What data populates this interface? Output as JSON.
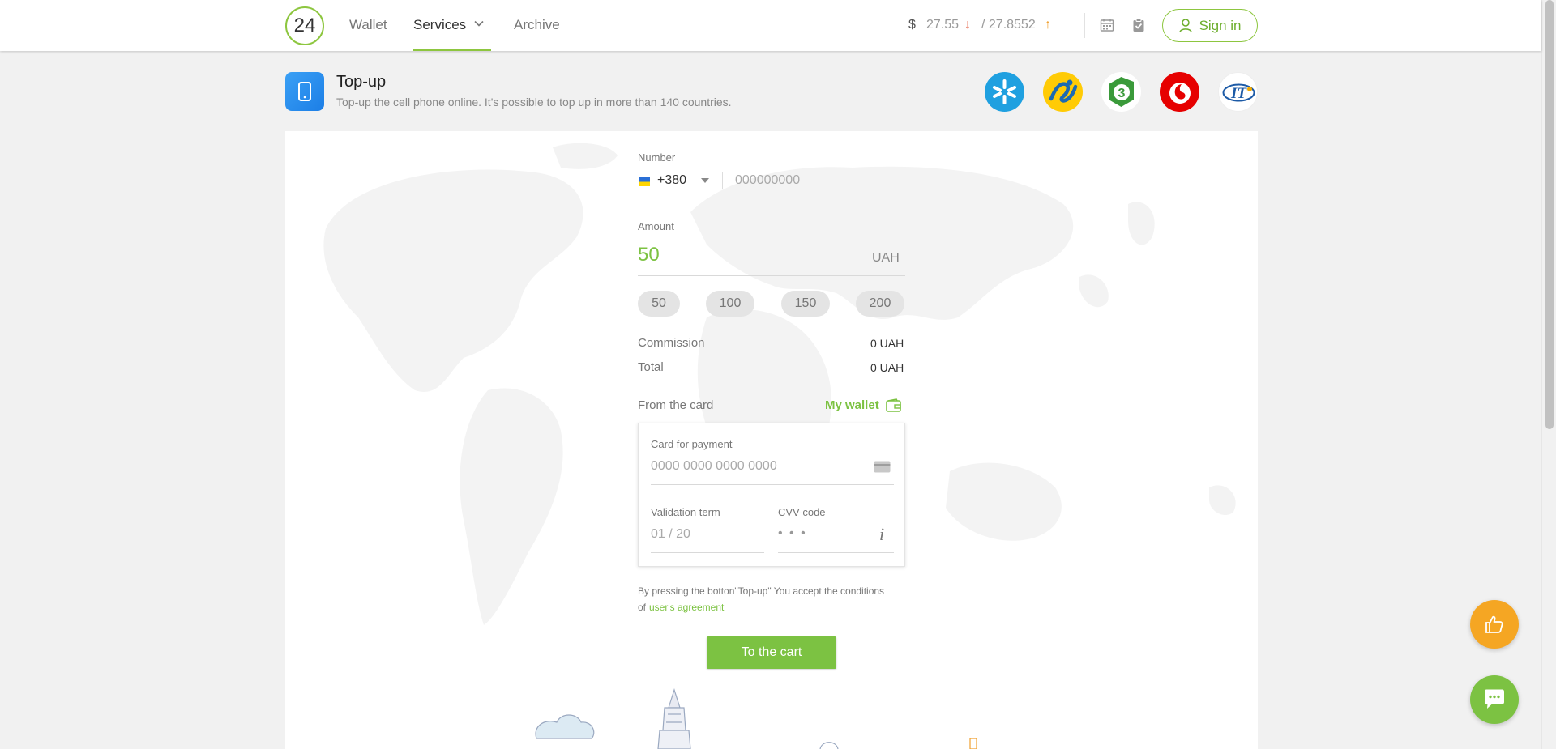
{
  "header": {
    "logo_text": "24",
    "nav": {
      "wallet": "Wallet",
      "services": "Services",
      "archive": "Archive"
    },
    "rates": {
      "currency_symbol": "$",
      "buy": "27.55",
      "buy_arrow": "↓",
      "sell": "/ 27.8552",
      "sell_arrow": "↑"
    },
    "signin_label": "Sign in",
    "accent_color": "#8dc63f"
  },
  "page": {
    "title": "Top-up",
    "subtitle": "Top-up the cell phone online. It's possible to top up in more than 140 countries.",
    "operators": [
      "kyivstar-logo",
      "lifecell-logo",
      "3mob-logo",
      "vodafone-logo",
      "intertelecom-logo"
    ]
  },
  "form": {
    "number_label": "Number",
    "country_code": "+380",
    "phone_placeholder": "000000000",
    "amount_label": "Amount",
    "amount_value": "50",
    "amount_currency": "UAH",
    "quick_amounts": [
      "50",
      "100",
      "150",
      "200"
    ],
    "commission_label": "Commission",
    "commission_value": "0 UAH",
    "total_label": "Total",
    "total_value": "0 UAH",
    "from_card_label": "From the card",
    "my_wallet_label": "My wallet",
    "card_label": "Card for payment",
    "card_placeholder": "0000 0000 0000 0000",
    "validation_label": "Validation term",
    "validation_placeholder": "01 / 20",
    "cvv_label": "CVV-code",
    "cvv_placeholder": "• • •",
    "agreement_text": "By pressing the botton\"Top-up\" You accept the conditions",
    "agreement_prefix": "of",
    "agreement_link": "user's agreement",
    "cart_button": "To the cart"
  }
}
